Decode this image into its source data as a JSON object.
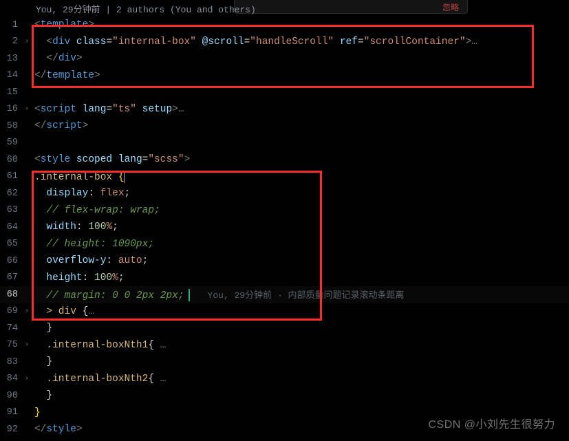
{
  "annotation": "You, 29分钟前 | 2 authors (You and others)",
  "gutters": [
    "1",
    "2",
    "13",
    "14",
    "15",
    "16",
    "58",
    "59",
    "60",
    "61",
    "62",
    "63",
    "64",
    "65",
    "66",
    "67",
    "68",
    "69",
    "74",
    "75",
    "83",
    "84",
    "90",
    "91",
    "92"
  ],
  "folds": [
    "",
    "›",
    "",
    "",
    "",
    "›",
    "",
    "",
    "",
    "",
    "",
    "",
    "",
    "",
    "",
    "",
    "",
    "›",
    "",
    "›",
    "",
    "›",
    "",
    "",
    ""
  ],
  "current_line_index": 17,
  "code": {
    "l1": {
      "open": "<",
      "tag": "template",
      "close": ">"
    },
    "l2": {
      "open": "<",
      "tag": "div",
      "a1": " class",
      "eq1": "=",
      "v1": "\"internal-box\"",
      "a2": " @scroll",
      "eq2": "=",
      "v2": "\"handleScroll\"",
      "a3": " ref",
      "eq3": "=",
      "v3": "\"scrollContainer\"",
      "close": ">",
      "dots": "…"
    },
    "l3": {
      "open": "</",
      "tag": "div",
      "close": ">"
    },
    "l4": {
      "open": "</",
      "tag": "template",
      "close": ">"
    },
    "l6": {
      "open": "<",
      "tag": "script",
      "a1": " lang",
      "eq1": "=",
      "v1": "\"ts\"",
      "a2": " setup",
      "close": ">",
      "dots": "…"
    },
    "l7": {
      "open": "</",
      "tag": "script",
      "close": ">"
    },
    "l9": {
      "open": "<",
      "tag": "style",
      "a1": " scoped",
      "a2": " lang",
      "eq2": "=",
      "v2": "\"scss\"",
      "close": ">"
    },
    "l10": {
      "sel": ".internal-box ",
      "brace": "{"
    },
    "l11": {
      "prop": "display",
      "colon": ": ",
      "val": "flex",
      "semi": ";"
    },
    "l12": {
      "comment": "// flex-wrap: wrap;"
    },
    "l13": {
      "prop": "width",
      "colon": ": ",
      "num": "100",
      "unit": "%",
      "semi": ";"
    },
    "l14": {
      "comment": "// height: 1090px;"
    },
    "l15": {
      "prop": "overflow-y",
      "colon": ": ",
      "val": "auto",
      "semi": ";"
    },
    "l16": {
      "prop": "height",
      "colon": ": ",
      "num": "100",
      "unit": "%",
      "semi": ";"
    },
    "l17": {
      "comment": "// margin: 0 0 2px 2px;"
    },
    "l18": {
      "sel": "> div ",
      "brace": "{",
      "dots": "…"
    },
    "l19": {
      "brace": "}"
    },
    "l20": {
      "sel": ".internal-boxNth1",
      "brace": "{",
      "dots": " …"
    },
    "l21": {
      "brace": "}"
    },
    "l22": {
      "sel": ".internal-boxNth2",
      "brace": "{",
      "dots": " …"
    },
    "l23": {
      "brace": "}"
    },
    "l24": {
      "brace": "}"
    },
    "l25": {
      "open": "</",
      "tag": "style",
      "close": ">"
    }
  },
  "inline_blame": "You, 29分钟前 · 内部质量问题记录滚动条距离",
  "watermark": "CSDN @小刘先生很努力",
  "topbar_button": "忽略"
}
